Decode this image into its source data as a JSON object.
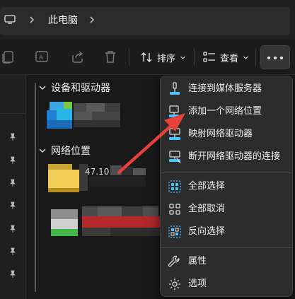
{
  "address_bar": {
    "breadcrumb": "此电脑",
    "location_icon": "monitor-icon"
  },
  "command_bar": {
    "sort_label": "排序",
    "view_label": "查看",
    "icons": [
      "copy-icon",
      "rename-icon",
      "share-icon",
      "delete-icon",
      "sort-icon",
      "view-icon",
      "more-icon"
    ]
  },
  "groups": [
    {
      "label": "设备和驱动器",
      "expanded": true
    },
    {
      "label": "网络位置",
      "expanded": true
    }
  ],
  "network_items": [
    {
      "label_visible_fragment": "47.10"
    }
  ],
  "context_menu": {
    "items": [
      {
        "label": "连接到媒体服务器",
        "icon": "media-server-icon"
      },
      {
        "label": "添加一个网络位置",
        "icon": "add-network-location-icon"
      },
      {
        "label": "映射网络驱动器",
        "icon": "map-network-drive-icon"
      },
      {
        "label": "断开网络驱动器的连接",
        "icon": "disconnect-network-drive-icon"
      },
      {
        "label": "全部选择",
        "icon": "select-all-icon"
      },
      {
        "label": "全部取消",
        "icon": "select-none-icon"
      },
      {
        "label": "反向选择",
        "icon": "invert-selection-icon"
      },
      {
        "label": "属性",
        "icon": "properties-icon"
      },
      {
        "label": "选项",
        "icon": "options-icon"
      }
    ]
  },
  "colors": {
    "accent": "#4cc2ff",
    "annotation_arrow": "#e8413c",
    "menu_background": "#2c2c2c",
    "window_background": "#191919"
  }
}
